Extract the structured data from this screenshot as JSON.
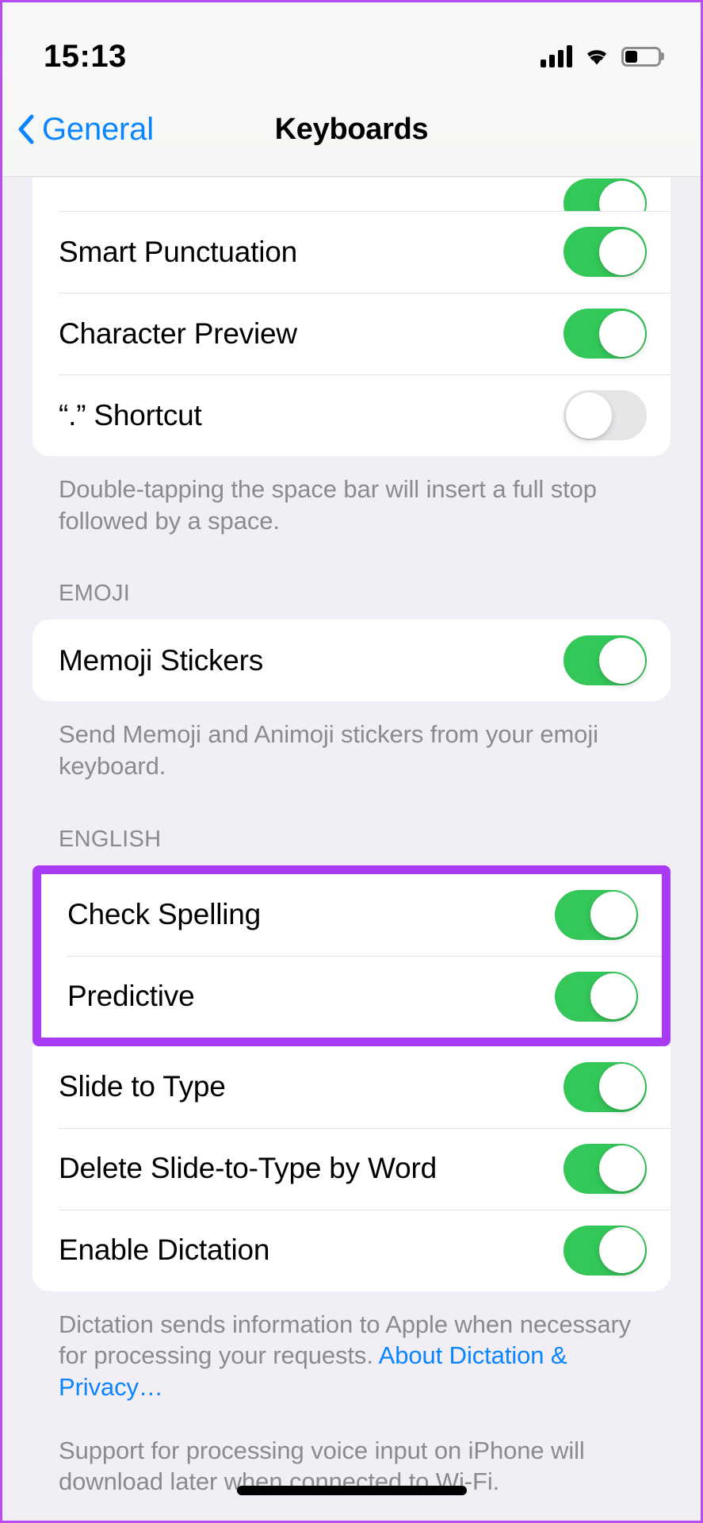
{
  "status_bar": {
    "time": "15:13",
    "signal_icon": "cellular-signal-icon",
    "wifi_icon": "wifi-icon",
    "battery_icon": "battery-icon",
    "battery_level_percent": 38
  },
  "nav": {
    "back_label": "General",
    "back_icon": "chevron-left-icon",
    "title": "Keyboards"
  },
  "colors": {
    "toggle_on": "#34C759",
    "toggle_off": "#E6E6E9",
    "link_blue": "#0A84FF",
    "highlight_purple": "#A93AF5",
    "page_background": "#F1EFF5"
  },
  "sections": [
    {
      "id": "all-keyboards",
      "header": "",
      "rows": [
        {
          "label": "",
          "toggle": "on",
          "clipped": true
        },
        {
          "label": "Smart Punctuation",
          "toggle": "on"
        },
        {
          "label": "Character Preview",
          "toggle": "on"
        },
        {
          "label": "“.” Shortcut",
          "toggle": "off"
        }
      ],
      "footer": "Double-tapping the space bar will insert a full stop followed by a space."
    },
    {
      "id": "emoji",
      "header": "EMOJI",
      "rows": [
        {
          "label": "Memoji Stickers",
          "toggle": "on"
        }
      ],
      "footer": "Send Memoji and Animoji stickers from your emoji keyboard."
    },
    {
      "id": "english",
      "header": "ENGLISH",
      "highlighted_rows": [
        {
          "label": "Check Spelling",
          "toggle": "on"
        },
        {
          "label": "Predictive",
          "toggle": "on"
        }
      ],
      "rows": [
        {
          "label": "Slide to Type",
          "toggle": "on"
        },
        {
          "label": "Delete Slide-to-Type by Word",
          "toggle": "on"
        },
        {
          "label": "Enable Dictation",
          "toggle": "on"
        }
      ],
      "footer_lead": "Dictation sends information to Apple when necessary for processing your requests. ",
      "footer_link": "About Dictation & Privacy…",
      "footer_second": "Support for processing voice input on iPhone will download later when connected to Wi-Fi."
    }
  ]
}
